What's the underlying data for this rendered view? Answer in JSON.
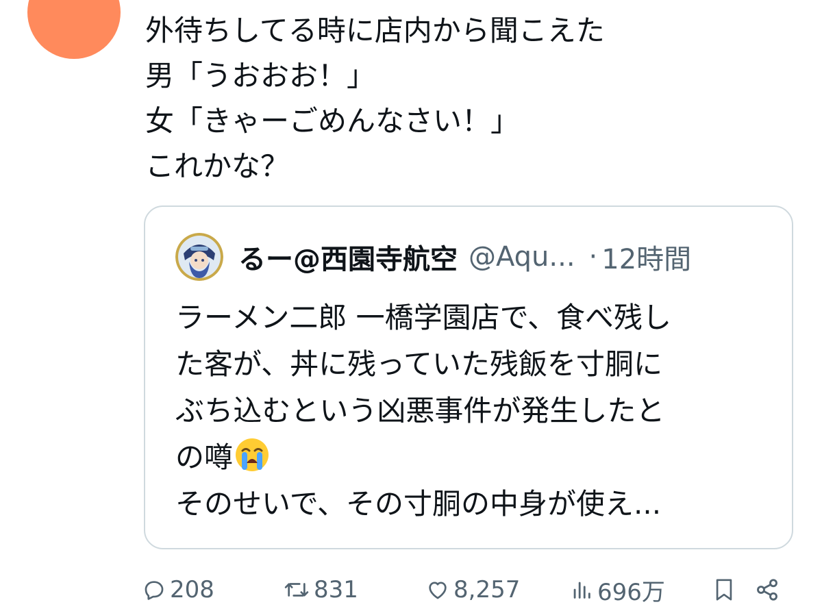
{
  "post": {
    "avatar_color": "#ff8a5c",
    "lines": [
      "外待ちしてる時に店内から聞こえた",
      "男「うおおお！」",
      "女「きゃーごめんなさい！」",
      "これかな？"
    ]
  },
  "quote": {
    "author_name": "るー@西園寺航空",
    "author_handle": "@Aqu...",
    "separator": "·",
    "time": "12時間",
    "lines": [
      "ラーメン二郎 一橋学園店で、食べ残し",
      "た客が、丼に残っていた残飯を寸胴に",
      "ぶち込むという凶悪事件が発生したと",
      "の噂",
      "そのせいで、その寸胴の中身が使え..."
    ],
    "emoji": "loudly-crying-face"
  },
  "actions": {
    "reply_count": "208",
    "repost_count": "831",
    "like_count": "8,257",
    "views_count": "696万",
    "icons": {
      "reply": "reply-icon",
      "repost": "repost-icon",
      "like": "like-icon",
      "views": "views-icon",
      "bookmark": "bookmark-icon",
      "share": "share-icon"
    }
  },
  "colors": {
    "text": "#0f1419",
    "secondary": "#536471",
    "border": "#cfd9de"
  }
}
